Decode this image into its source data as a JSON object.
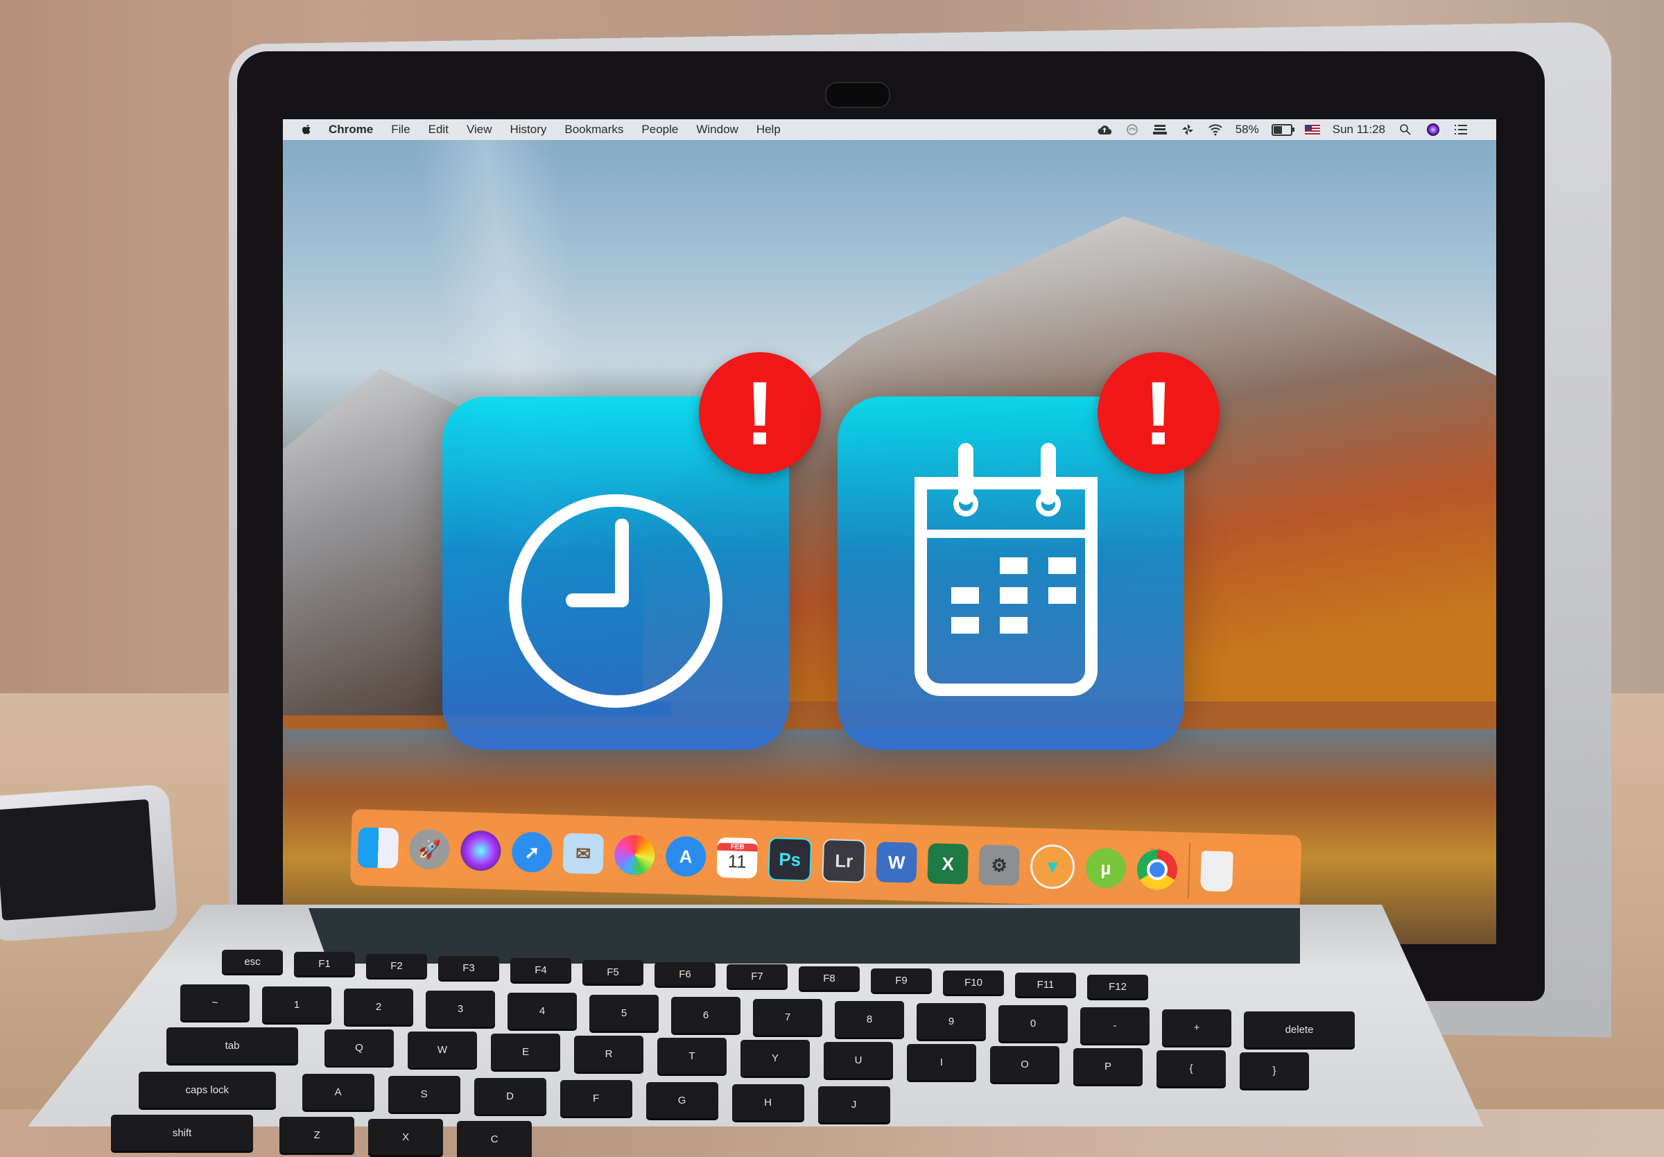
{
  "menubar": {
    "apple_icon": "apple-icon",
    "app_name": "Chrome",
    "items": [
      "File",
      "Edit",
      "View",
      "History",
      "Bookmarks",
      "People",
      "Window",
      "Help"
    ],
    "status": {
      "icons": [
        "cloud-upload-icon",
        "creative-cloud-icon",
        "drive-icon",
        "pinwheel-icon",
        "wifi-icon"
      ],
      "battery_percent_label": "58%",
      "battery_level": 0.58,
      "input_source": "us-flag-icon",
      "clock": "Sun 11:28",
      "spotlight_icon": "search-icon",
      "siri_icon": "siri-icon",
      "notification_icon": "list-icon"
    }
  },
  "overlay": {
    "tiles": [
      {
        "name": "clock",
        "icon": "clock-icon",
        "badge": "!"
      },
      {
        "name": "calendar",
        "icon": "calendar-icon",
        "badge": "!"
      }
    ]
  },
  "dock": {
    "items": [
      {
        "name": "Finder",
        "icon": "finder-icon"
      },
      {
        "name": "Launchpad",
        "icon": "rocket-icon"
      },
      {
        "name": "Siri",
        "icon": "siri-icon"
      },
      {
        "name": "Safari",
        "icon": "compass-icon"
      },
      {
        "name": "Mail",
        "icon": "stamp-icon"
      },
      {
        "name": "Photos",
        "icon": "flower-icon"
      },
      {
        "name": "App Store",
        "icon": "app-store-icon"
      },
      {
        "name": "Calendar",
        "icon": "calendar-icon",
        "month": "FEB",
        "day": "11"
      },
      {
        "name": "Photoshop",
        "icon": "photoshop-icon",
        "label": "Ps"
      },
      {
        "name": "Lightroom",
        "icon": "lightroom-icon",
        "label": "Lr"
      },
      {
        "name": "Word",
        "icon": "word-icon",
        "label": "W"
      },
      {
        "name": "Excel",
        "icon": "excel-icon",
        "label": "X"
      },
      {
        "name": "System Preferences",
        "icon": "gear-icon"
      },
      {
        "name": "Transmit",
        "icon": "transfer-icon"
      },
      {
        "name": "uTorrent",
        "icon": "utorrent-icon",
        "label": "µ"
      },
      {
        "name": "Chrome",
        "icon": "chrome-icon"
      },
      {
        "name": "Trash",
        "icon": "trash-icon"
      }
    ]
  },
  "keyboard": {
    "row_fn": [
      "esc",
      "F1",
      "F2",
      "F3",
      "F4",
      "F5",
      "F6",
      "F7",
      "F8",
      "F9",
      "F10",
      "F11",
      "F12"
    ],
    "row_num": [
      "~",
      "1",
      "2",
      "3",
      "4",
      "5",
      "6",
      "7",
      "8",
      "9",
      "0",
      "-",
      "+",
      "delete"
    ],
    "row_q": [
      "tab",
      "Q",
      "W",
      "E",
      "R",
      "T",
      "Y",
      "U",
      "I",
      "O",
      "P",
      "{",
      "}"
    ],
    "row_a": [
      "caps lock",
      "A",
      "S",
      "D",
      "F",
      "G",
      "H",
      "J"
    ],
    "row_z": [
      "shift",
      "Z",
      "X",
      "C"
    ]
  }
}
